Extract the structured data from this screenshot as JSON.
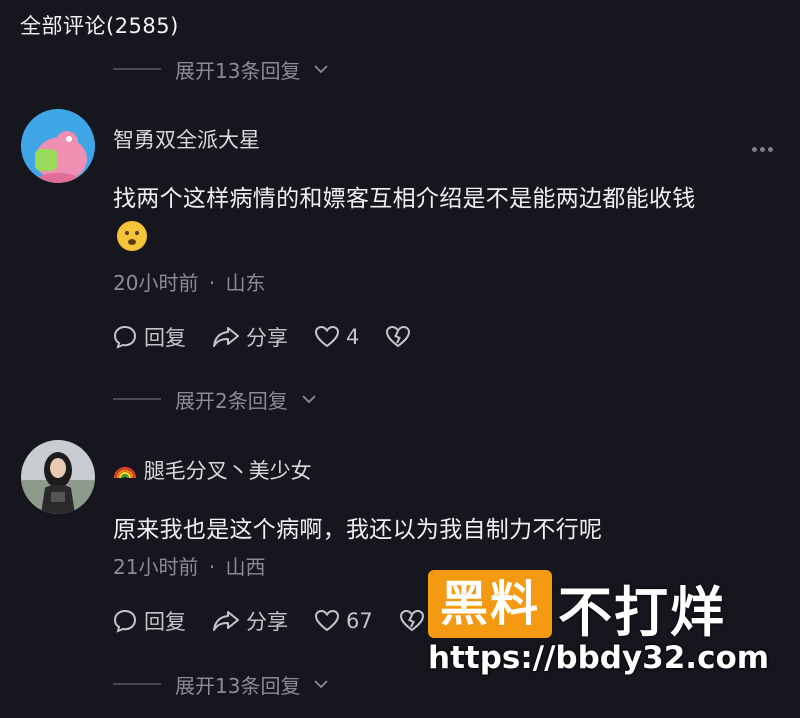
{
  "header": {
    "title": "全部评论(2585)"
  },
  "expand": {
    "top_label": "展开13条回复",
    "mid_label": "展开2条回复",
    "bottom_label": "展开13条回复"
  },
  "comments": [
    {
      "username": "智勇双全派大星",
      "text": "找两个这样病情的和嫖客互相介绍是不是能两边都能收钱",
      "time": "20小时前",
      "separator": "·",
      "location": "山东",
      "reply_label": "回复",
      "share_label": "分享",
      "likes": "4"
    },
    {
      "username_prefix_icon": "rainbow-icon",
      "username": "腿毛分叉丶美少女",
      "text": "原来我也是这个病啊，我还以为我自制力不行呢",
      "time": "21小时前",
      "separator": "·",
      "location": "山西",
      "reply_label": "回复",
      "share_label": "分享",
      "likes": "67"
    }
  ],
  "watermark": {
    "badge": "黑料",
    "text": "不打烊",
    "url": "https://bbdy32.com"
  },
  "colors": {
    "background": "#16161e",
    "muted_text": "#8b8b96",
    "watermark_badge": "#f39a12"
  }
}
